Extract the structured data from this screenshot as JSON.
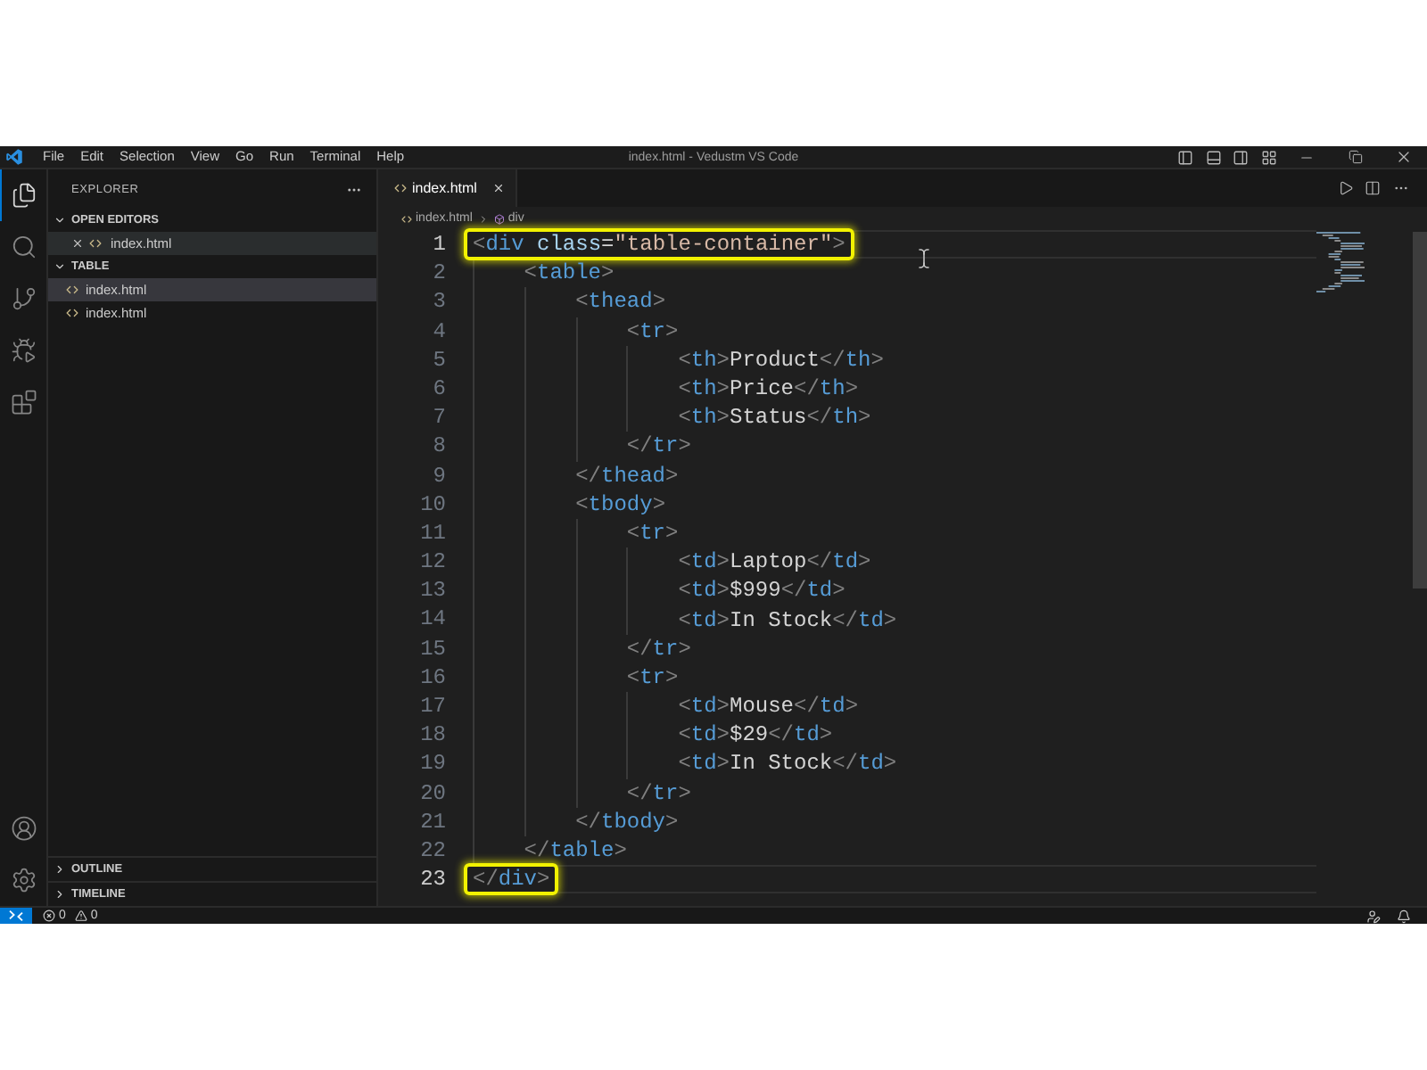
{
  "window": {
    "title": "index.html - Vedustm VS Code"
  },
  "menu": [
    "File",
    "Edit",
    "Selection",
    "View",
    "Go",
    "Run",
    "Terminal",
    "Help"
  ],
  "activity_bar": [
    {
      "kind": "explorer",
      "selected": true
    },
    {
      "kind": "search",
      "selected": false
    },
    {
      "kind": "source_control",
      "selected": false
    },
    {
      "kind": "run_debug",
      "selected": false
    },
    {
      "kind": "extensions",
      "selected": false
    }
  ],
  "sidebar": {
    "title": "EXPLORER",
    "sections": [
      {
        "kind": "open_editors",
        "label": "OPEN EDITORS",
        "expanded": true,
        "items": [
          {
            "label": "index.html",
            "selected": false,
            "hovered": true
          }
        ]
      },
      {
        "kind": "folder",
        "label": "TABLE",
        "expanded": true,
        "items": [
          {
            "label": "index.html",
            "selected": true
          },
          {
            "label": "index.html",
            "selected": false
          }
        ]
      },
      {
        "kind": "panel",
        "label": "OUTLINE",
        "expanded": false
      },
      {
        "kind": "panel",
        "label": "TIMELINE",
        "expanded": false
      }
    ]
  },
  "editor": {
    "tabs": [
      {
        "label": "index.html",
        "selected": true
      }
    ],
    "breadcrumb": [
      "index.html",
      "div"
    ],
    "lines": [
      {
        "number": "1",
        "text": "<div class=\"table-container\">",
        "current": true,
        "highlighted": true
      },
      {
        "number": "2",
        "text": "    <table>",
        "current": false,
        "highlighted": false
      },
      {
        "number": "3",
        "text": "        <thead>",
        "current": false,
        "highlighted": false
      },
      {
        "number": "4",
        "text": "            <tr>",
        "current": false,
        "highlighted": false
      },
      {
        "number": "5",
        "text": "                <th>Product</th>",
        "current": false,
        "highlighted": false
      },
      {
        "number": "6",
        "text": "                <th>Price</th>",
        "current": false,
        "highlighted": false
      },
      {
        "number": "7",
        "text": "                <th>Status</th>",
        "current": false,
        "highlighted": false
      },
      {
        "number": "8",
        "text": "            </tr>",
        "current": false,
        "highlighted": false
      },
      {
        "number": "9",
        "text": "        </thead>",
        "current": false,
        "highlighted": false
      },
      {
        "number": "10",
        "text": "        <tbody>",
        "current": false,
        "highlighted": false
      },
      {
        "number": "11",
        "text": "            <tr>",
        "current": false,
        "highlighted": false
      },
      {
        "number": "12",
        "text": "                <td>Laptop</td>",
        "current": false,
        "highlighted": false
      },
      {
        "number": "13",
        "text": "                <td>$999</td>",
        "current": false,
        "highlighted": false
      },
      {
        "number": "14",
        "text": "                <td>In Stock</td>",
        "current": false,
        "highlighted": false
      },
      {
        "number": "15",
        "text": "            </tr>",
        "current": false,
        "highlighted": false
      },
      {
        "number": "16",
        "text": "            <tr>",
        "current": false,
        "highlighted": false
      },
      {
        "number": "17",
        "text": "                <td>Mouse</td>",
        "current": false,
        "highlighted": false
      },
      {
        "number": "18",
        "text": "                <td>$29</td>",
        "current": false,
        "highlighted": false
      },
      {
        "number": "19",
        "text": "                <td>In Stock</td>",
        "current": false,
        "highlighted": false
      },
      {
        "number": "20",
        "text": "            </tr>",
        "current": false,
        "highlighted": false
      },
      {
        "number": "21",
        "text": "        </tbody>",
        "current": false,
        "highlighted": false
      },
      {
        "number": "22",
        "text": "    </table>",
        "current": false,
        "highlighted": false
      },
      {
        "number": "23",
        "text": "</div>",
        "current": true,
        "highlighted": true
      }
    ]
  },
  "status_bar": {
    "errors": "0",
    "warnings": "0"
  }
}
